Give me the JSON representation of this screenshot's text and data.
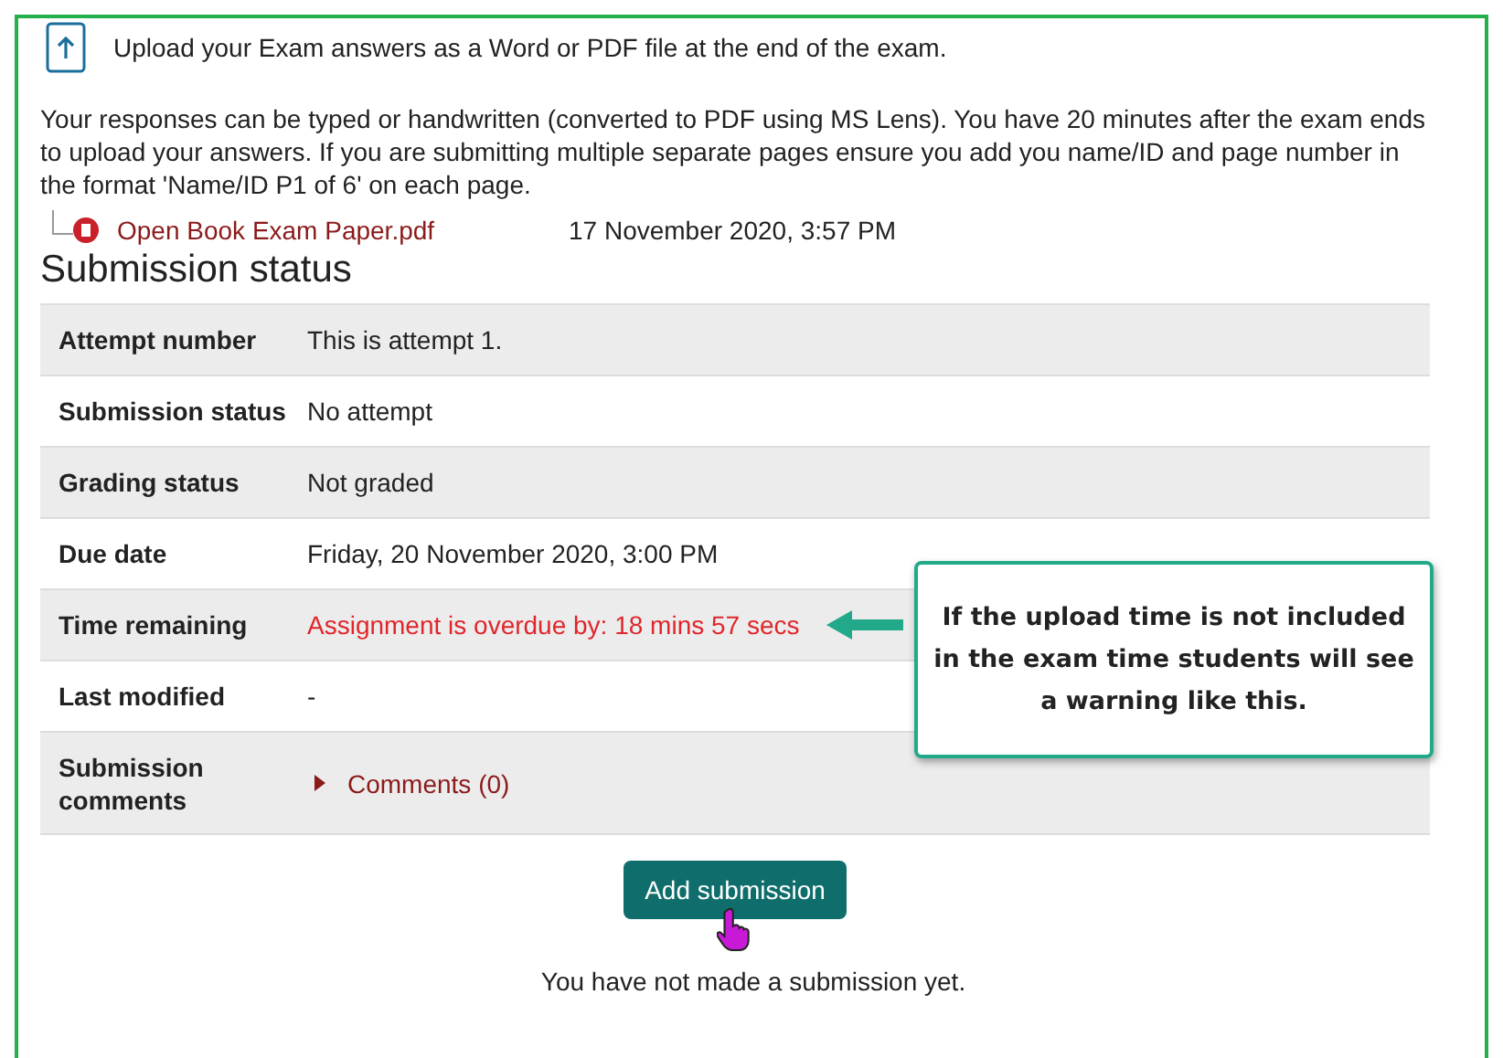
{
  "upload_note": "Upload your Exam answers as a Word or PDF file at the end of the exam.",
  "description": "Your responses can be typed or handwritten (converted to PDF using MS Lens). You have 20 minutes after the exam ends to upload your answers. If you are submitting multiple separate pages ensure you add you name/ID and page number in the format 'Name/ID P1 of 6' on each page.",
  "attachment": {
    "name": "Open Book Exam Paper.pdf",
    "date": "17 November 2020, 3:57 PM"
  },
  "heading": "Submission status",
  "rows": [
    {
      "label": "Attempt number",
      "value": "This is attempt 1.",
      "kind": "text"
    },
    {
      "label": "Submission status",
      "value": "No attempt",
      "kind": "text"
    },
    {
      "label": "Grading status",
      "value": "Not graded",
      "kind": "text"
    },
    {
      "label": "Due date",
      "value": "Friday, 20 November 2020, 3:00 PM",
      "kind": "text"
    },
    {
      "label": "Time remaining",
      "value": "Assignment is overdue by: 18 mins 57 secs",
      "kind": "warning"
    },
    {
      "label": "Last modified",
      "value": "-",
      "kind": "text"
    },
    {
      "label": "Submission comments",
      "value": "Comments (0)",
      "kind": "comments"
    }
  ],
  "button": "Add submission",
  "footer_note": "You have not made a submission yet.",
  "callout": "If the upload time is not included in the exam time students will see a warning like this."
}
